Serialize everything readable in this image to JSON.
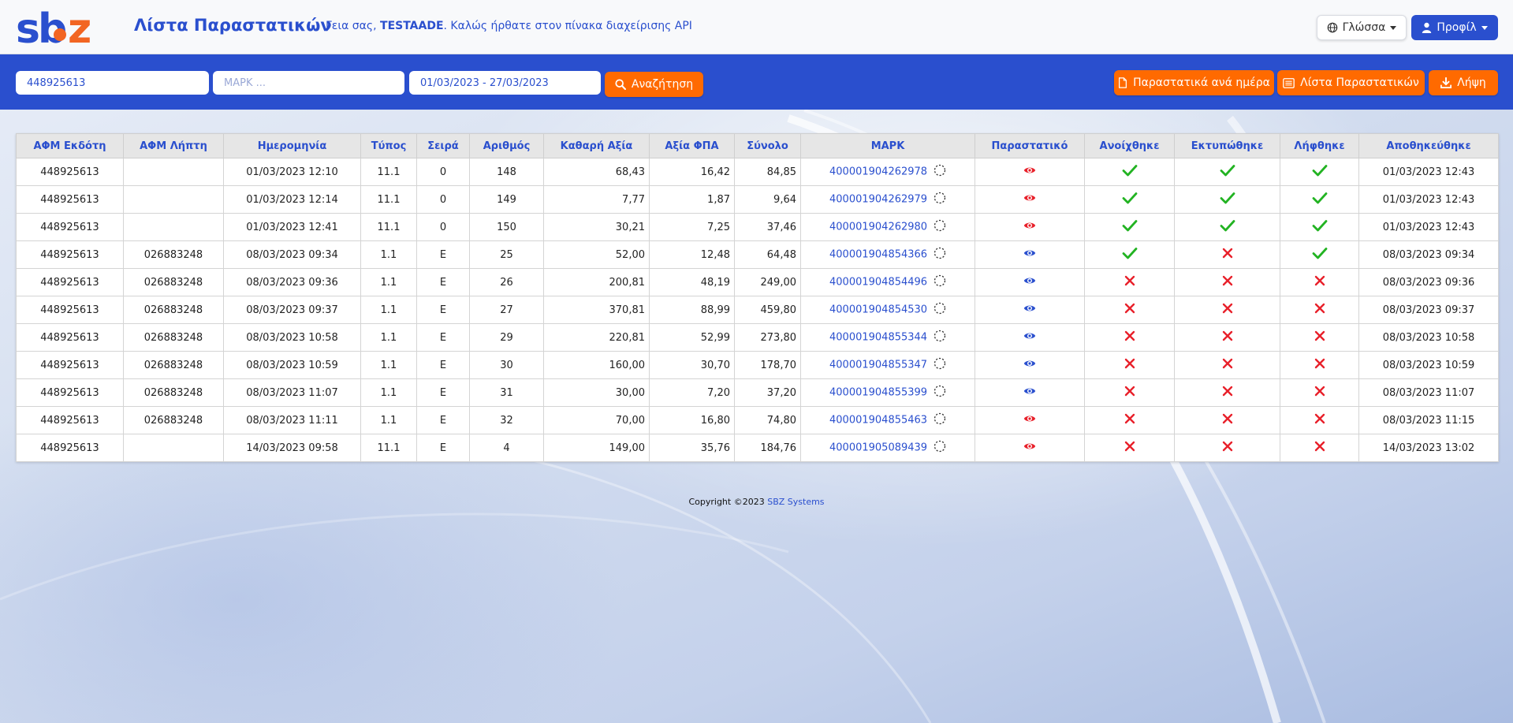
{
  "brand": {
    "logo_text": "sbz",
    "logo_text_end": "z"
  },
  "header": {
    "title": "Λίστα Παραστατικών",
    "welcome_prefix": "Γεια σας, ",
    "welcome_user": "TESTAADE",
    "welcome_suffix": ". Καλώς ήρθατε στον πίνακα διαχείρισης API",
    "language_label": "Γλώσσα",
    "profile_label": "Προφίλ"
  },
  "toolbar": {
    "afm_value": "448925613",
    "mark_value": "",
    "mark_placeholder": "ΜΑΡΚ ...",
    "date_range_value": "01/03/2023 - 27/03/2023",
    "search_label": "Αναζήτηση",
    "per_day_label": "Παραστατικά ανά ημέρα",
    "list_label": "Λίστα Παραστατικών",
    "download_label": "Λήψη"
  },
  "colors": {
    "brand_blue": "#2a4fce",
    "brand_orange": "#ff6a00",
    "ok_green": "#22b322",
    "no_red": "#e8202a"
  },
  "table": {
    "columns": [
      "ΑΦΜ Εκδότη",
      "ΑΦΜ Λήπτη",
      "Ημερομηνία",
      "Τύπος",
      "Σειρά",
      "Αριθμός",
      "Καθαρή Αξία",
      "Αξία ΦΠΑ",
      "Σύνολο",
      "ΜΑΡΚ",
      "Παραστατικό",
      "Ανοίχθηκε",
      "Εκτυπώθηκε",
      "Λήφθηκε",
      "Αποθηκεύθηκε"
    ],
    "rows": [
      {
        "afm_issuer": "448925613",
        "afm_recipient": "",
        "date": "01/03/2023 12:10",
        "type": "11.1",
        "series": "0",
        "number": "148",
        "net": "68,43",
        "vat": "16,42",
        "total": "84,85",
        "mark": "400001904262978",
        "doc_icon": "eye-icon-red",
        "opened": true,
        "printed": true,
        "received": true,
        "saved": "01/03/2023 12:43"
      },
      {
        "afm_issuer": "448925613",
        "afm_recipient": "",
        "date": "01/03/2023 12:14",
        "type": "11.1",
        "series": "0",
        "number": "149",
        "net": "7,77",
        "vat": "1,87",
        "total": "9,64",
        "mark": "400001904262979",
        "doc_icon": "eye-icon-red",
        "opened": true,
        "printed": true,
        "received": true,
        "saved": "01/03/2023 12:43"
      },
      {
        "afm_issuer": "448925613",
        "afm_recipient": "",
        "date": "01/03/2023 12:41",
        "type": "11.1",
        "series": "0",
        "number": "150",
        "net": "30,21",
        "vat": "7,25",
        "total": "37,46",
        "mark": "400001904262980",
        "doc_icon": "eye-icon-red",
        "opened": true,
        "printed": true,
        "received": true,
        "saved": "01/03/2023 12:43"
      },
      {
        "afm_issuer": "448925613",
        "afm_recipient": "026883248",
        "date": "08/03/2023 09:34",
        "type": "1.1",
        "series": "E",
        "number": "25",
        "net": "52,00",
        "vat": "12,48",
        "total": "64,48",
        "mark": "400001904854366",
        "doc_icon": "eye-icon-blue",
        "opened": true,
        "printed": false,
        "received": true,
        "saved": "08/03/2023 09:34"
      },
      {
        "afm_issuer": "448925613",
        "afm_recipient": "026883248",
        "date": "08/03/2023 09:36",
        "type": "1.1",
        "series": "E",
        "number": "26",
        "net": "200,81",
        "vat": "48,19",
        "total": "249,00",
        "mark": "400001904854496",
        "doc_icon": "eye-icon-blue",
        "opened": false,
        "printed": false,
        "received": false,
        "saved": "08/03/2023 09:36"
      },
      {
        "afm_issuer": "448925613",
        "afm_recipient": "026883248",
        "date": "08/03/2023 09:37",
        "type": "1.1",
        "series": "E",
        "number": "27",
        "net": "370,81",
        "vat": "88,99",
        "total": "459,80",
        "mark": "400001904854530",
        "doc_icon": "eye-icon-blue",
        "opened": false,
        "printed": false,
        "received": false,
        "saved": "08/03/2023 09:37"
      },
      {
        "afm_issuer": "448925613",
        "afm_recipient": "026883248",
        "date": "08/03/2023 10:58",
        "type": "1.1",
        "series": "E",
        "number": "29",
        "net": "220,81",
        "vat": "52,99",
        "total": "273,80",
        "mark": "400001904855344",
        "doc_icon": "eye-icon-blue",
        "opened": false,
        "printed": false,
        "received": false,
        "saved": "08/03/2023 10:58"
      },
      {
        "afm_issuer": "448925613",
        "afm_recipient": "026883248",
        "date": "08/03/2023 10:59",
        "type": "1.1",
        "series": "E",
        "number": "30",
        "net": "160,00",
        "vat": "30,70",
        "total": "178,70",
        "mark": "400001904855347",
        "doc_icon": "eye-icon-blue",
        "opened": false,
        "printed": false,
        "received": false,
        "saved": "08/03/2023 10:59"
      },
      {
        "afm_issuer": "448925613",
        "afm_recipient": "026883248",
        "date": "08/03/2023 11:07",
        "type": "1.1",
        "series": "E",
        "number": "31",
        "net": "30,00",
        "vat": "7,20",
        "total": "37,20",
        "mark": "400001904855399",
        "doc_icon": "eye-icon-blue",
        "opened": false,
        "printed": false,
        "received": false,
        "saved": "08/03/2023 11:07"
      },
      {
        "afm_issuer": "448925613",
        "afm_recipient": "026883248",
        "date": "08/03/2023 11:11",
        "type": "1.1",
        "series": "E",
        "number": "32",
        "net": "70,00",
        "vat": "16,80",
        "total": "74,80",
        "mark": "400001904855463",
        "doc_icon": "eye-icon-red",
        "opened": false,
        "printed": false,
        "received": false,
        "saved": "08/03/2023 11:15"
      },
      {
        "afm_issuer": "448925613",
        "afm_recipient": "",
        "date": "14/03/2023 09:58",
        "type": "11.1",
        "series": "E",
        "number": "4",
        "net": "149,00",
        "vat": "35,76",
        "total": "184,76",
        "mark": "400001905089439",
        "doc_icon": "eye-icon-red",
        "opened": false,
        "printed": false,
        "received": false,
        "saved": "14/03/2023 13:02"
      }
    ]
  },
  "footer": {
    "copyright": "Copyright ©2023 ",
    "company": "SBZ Systems"
  }
}
